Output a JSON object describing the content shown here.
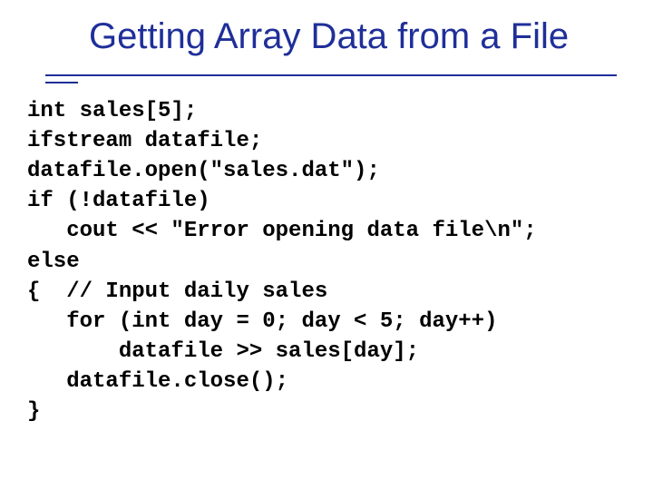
{
  "title": "Getting Array Data from a File",
  "code": {
    "l1": "int sales[5];",
    "l2": "ifstream datafile;",
    "l3": "datafile.open(\"sales.dat\");",
    "l4": "if (!datafile)",
    "l5": "   cout << \"Error opening data file\\n\";",
    "l6": "else",
    "l7": "{  // Input daily sales",
    "l8": "   for (int day = 0; day < 5; day++)",
    "l9": "       datafile >> sales[day];",
    "l10": "   datafile.close();",
    "l11": "}"
  }
}
